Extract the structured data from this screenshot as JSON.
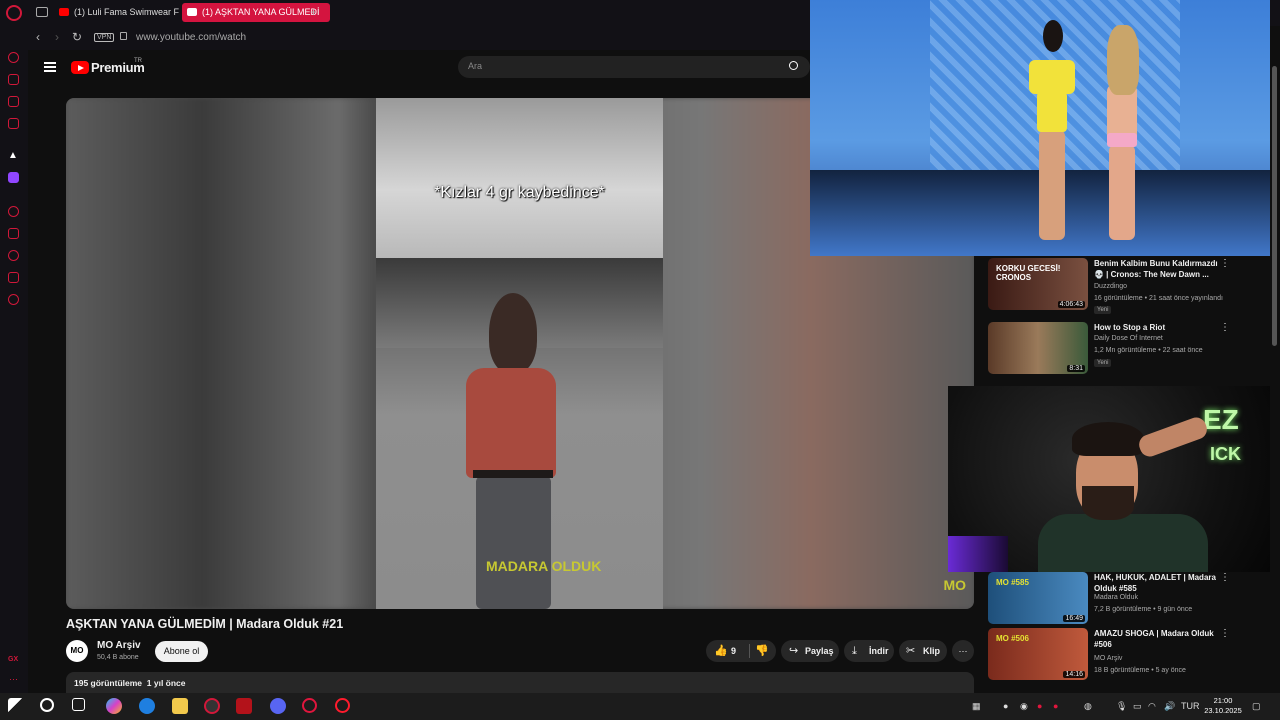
{
  "browser": {
    "tabs": [
      {
        "label": "(1) Luli Fama Swimwear F",
        "active": false
      },
      {
        "label": "(1) AŞKTAN YANA GÜLMEDİ",
        "active": true
      }
    ],
    "new_tab": "+",
    "vpn_label": "VPN",
    "url": "www.youtube.com/watch",
    "sidebar_badge": "GX"
  },
  "youtube": {
    "logo_text": "Premium",
    "logo_region": "TR",
    "search_placeholder": "Ara"
  },
  "video": {
    "overlay_caption": "*Kızlar 4 gr kaybedince*",
    "watermark": "MADARA OLDUK",
    "corner_logo": "MO",
    "title": "AŞKTAN YANA GÜLMEDİM | Madara Olduk #21",
    "channel_avatar": "MO",
    "channel": "MO Arşiv",
    "subscribers": "50,4 B abone",
    "subscribe_label": "Abone ol",
    "like_count": "9",
    "share_label": "Paylaş",
    "download_label": "İndir",
    "clip_label": "Klip",
    "more_label": "⋯",
    "views": "195 görüntüleme",
    "age": "1 yıl önce"
  },
  "suggestions": [
    {
      "thumb_text": "KORKU GECESİ! CRONOS",
      "duration": "4:06:43",
      "title": "Benim Kalbim Bunu Kaldırmazdı 💀 | Cronos: The New Dawn ...",
      "channel": "Duzzdingo",
      "meta": "16 görüntüleme • 21 saat önce yayınlandı",
      "badge": "Yeni",
      "thumb_color": "#6b2a1f"
    },
    {
      "thumb_text": "",
      "duration": "8:31",
      "title": "How to Stop a Riot",
      "channel": "Daily Dose Of Internet",
      "meta": "1,2 Mn görüntüleme • 22 saat önce",
      "badge": "Yeni",
      "thumb_color": "#8a6b4e"
    },
    {
      "thumb_text": "MO #585",
      "duration": "16:49",
      "title": "HAK, HUKUK, ADALET | Madara Olduk #585",
      "channel": "Madara Olduk",
      "meta": "7,2 B görüntüleme • 9 gün önce",
      "badge": "",
      "thumb_color": "#2f6ea3"
    },
    {
      "thumb_text": "MO #506",
      "duration": "14:16",
      "title": "AMAZU SHOGA | Madara Olduk #506",
      "channel": "MO Arşiv",
      "meta": "18 B görüntüleme • 5 ay önce",
      "badge": "",
      "thumb_color": "#a83f2c"
    }
  ],
  "webcam": {
    "neon_line1": "EZ",
    "neon_line2": "ICK"
  },
  "taskbar": {
    "language": "TUR",
    "time": "21:00",
    "date": "23.10.2025"
  },
  "colors": {
    "opera_red": "#d1183a",
    "yt_red": "#ff0000",
    "tab_active": "#d4143f"
  }
}
